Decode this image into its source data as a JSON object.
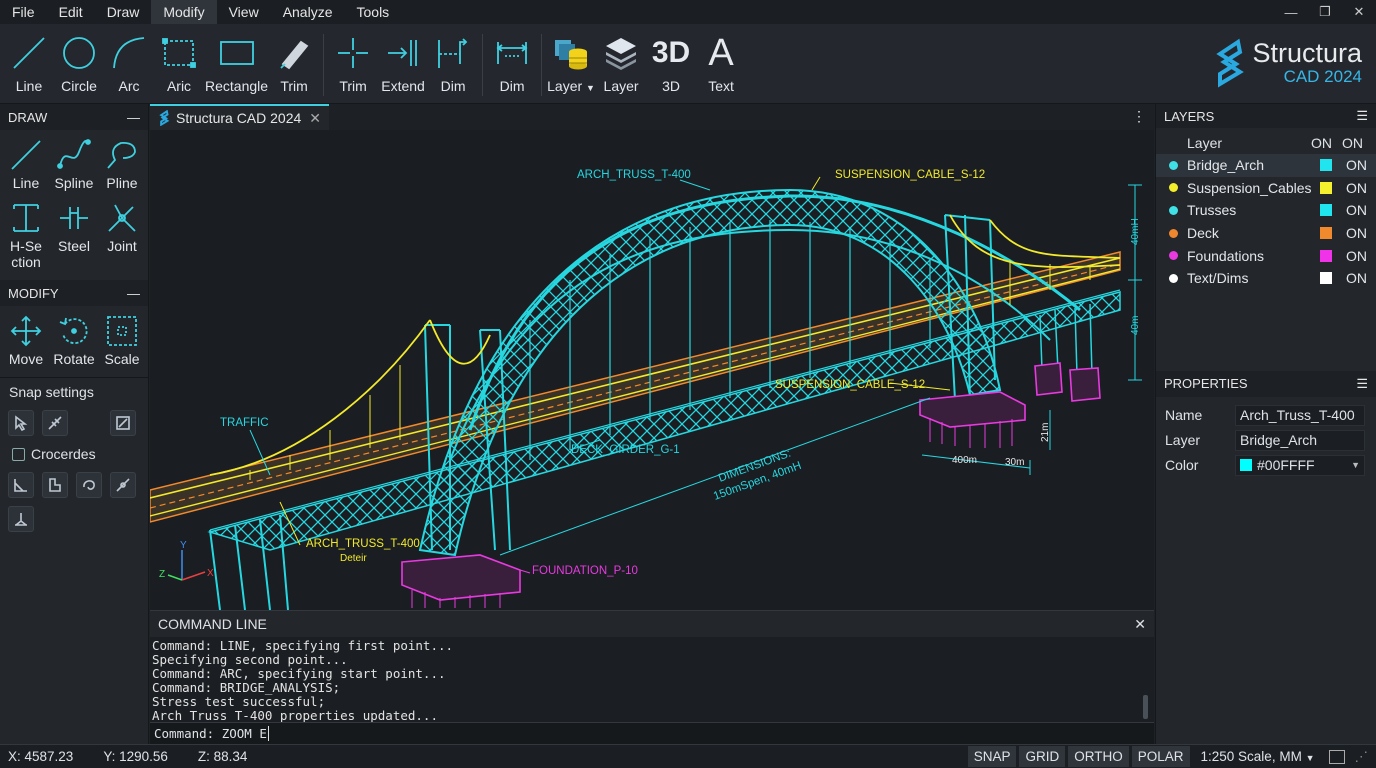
{
  "menu": [
    "File",
    "Edit",
    "Draw",
    "Modify",
    "View",
    "Analyze",
    "Tools"
  ],
  "menu_active": "Modify",
  "window_controls": {
    "minimize": "—",
    "restore": "❐",
    "close": "✕"
  },
  "ribbon": {
    "line": "Line",
    "circle": "Circle",
    "arc": "Arc",
    "aric": "Aric",
    "rectangle": "Rectangle",
    "trim1": "Trim",
    "trim2": "Trim",
    "extend": "Extend",
    "dim1": "Dim",
    "dim2": "Dim",
    "layer_dd": "Layer",
    "layer": "Layer",
    "three_d": "3D",
    "text": "Text"
  },
  "brand": {
    "name": "Structura",
    "sub": "CAD 2024"
  },
  "left": {
    "draw_title": "DRAW",
    "modify_title": "MODIFY",
    "draw": {
      "line": "Line",
      "spline": "Spline",
      "pline": "Pline",
      "hsection": "H-Se ction",
      "steel": "Steel",
      "joint": "Joint"
    },
    "modify": {
      "move": "Move",
      "rotate": "Rotate",
      "scale": "Scale"
    },
    "snap_title": "Snap settings",
    "crocerdes": "Crocerdes",
    "collapse": "—"
  },
  "tab": {
    "title": "Structura CAD 2024",
    "close": "✕",
    "menu": "⋮"
  },
  "drawing": {
    "arch_truss_top": "ARCH_TRUSS_T-400",
    "susp_top": "SUSPENSION_CABLE_S-12",
    "susp_mid": "SUSPENSION_CABLE_S-12",
    "traffic": "TRAFFIC",
    "deck_girder": "DECK_GIRDER_G-1",
    "dims1": "DIMENSIONS:",
    "dims2": "150mSpen, 40mH",
    "arch_truss_bottom": "ARCH_TRUSS_T-400",
    "detail": "Deteir",
    "foundation": "FOUNDATION_P-10",
    "dim_40mh": "40mH",
    "dim_40m": "40m",
    "dim_400m": "400m",
    "dim_21m": "21m",
    "dim_30m": "30m",
    "axis_x": "X",
    "axis_y": "Y",
    "axis_z": "Z"
  },
  "layers": {
    "title": "LAYERS",
    "col_layer": "Layer",
    "col_on1": "ON",
    "col_on2": "ON",
    "rows": [
      {
        "name": "Bridge_Arch",
        "dot": "#3fe0e6",
        "swatch": "#20e4ee",
        "state": "ON"
      },
      {
        "name": "Suspension_Cables",
        "dot": "#f2ef2a",
        "swatch": "#f4f02e",
        "state": "ON"
      },
      {
        "name": "Trusses",
        "dot": "#3fe0e6",
        "swatch": "#20e4ee",
        "state": "ON"
      },
      {
        "name": "Deck",
        "dot": "#f0872e",
        "swatch": "#f08a2c",
        "state": "ON"
      },
      {
        "name": "Foundations",
        "dot": "#e83ae0",
        "swatch": "#f032e8",
        "state": "ON"
      },
      {
        "name": "Text/Dims",
        "dot": "#ffffff",
        "swatch": "#ffffff",
        "state": "ON"
      }
    ]
  },
  "properties": {
    "title": "PROPERTIES",
    "name_label": "Name",
    "name_value": "Arch_Truss_T-400",
    "layer_label": "Layer",
    "layer_value": "Bridge_Arch",
    "color_label": "Color",
    "color_value": "#00FFFF",
    "color_swatch": "#00ffff"
  },
  "command": {
    "title": "COMMAND LINE",
    "close": "✕",
    "log": [
      "Command: LINE, specifying first point...",
      "Specifying second point...",
      "Command: ARC, specifying start point...",
      "Command: BRIDGE_ANALYSIS;",
      "Stress test successful;",
      "Arch_Truss_T-400 properties updated..."
    ],
    "input": "Command: ZOOM E"
  },
  "status": {
    "x": "X: 4587.23",
    "y": "Y: 1290.56",
    "z": "Z: 88.34",
    "snap": "SNAP",
    "grid": "GRID",
    "ortho": "ORTHO",
    "polar": "POLAR",
    "scale": "1:250 Scale, MM"
  },
  "colors": {
    "accent": "#3fd0e0",
    "cable": "#f4f02e",
    "deck": "#f08a2c",
    "foundation": "#e83ae0"
  }
}
